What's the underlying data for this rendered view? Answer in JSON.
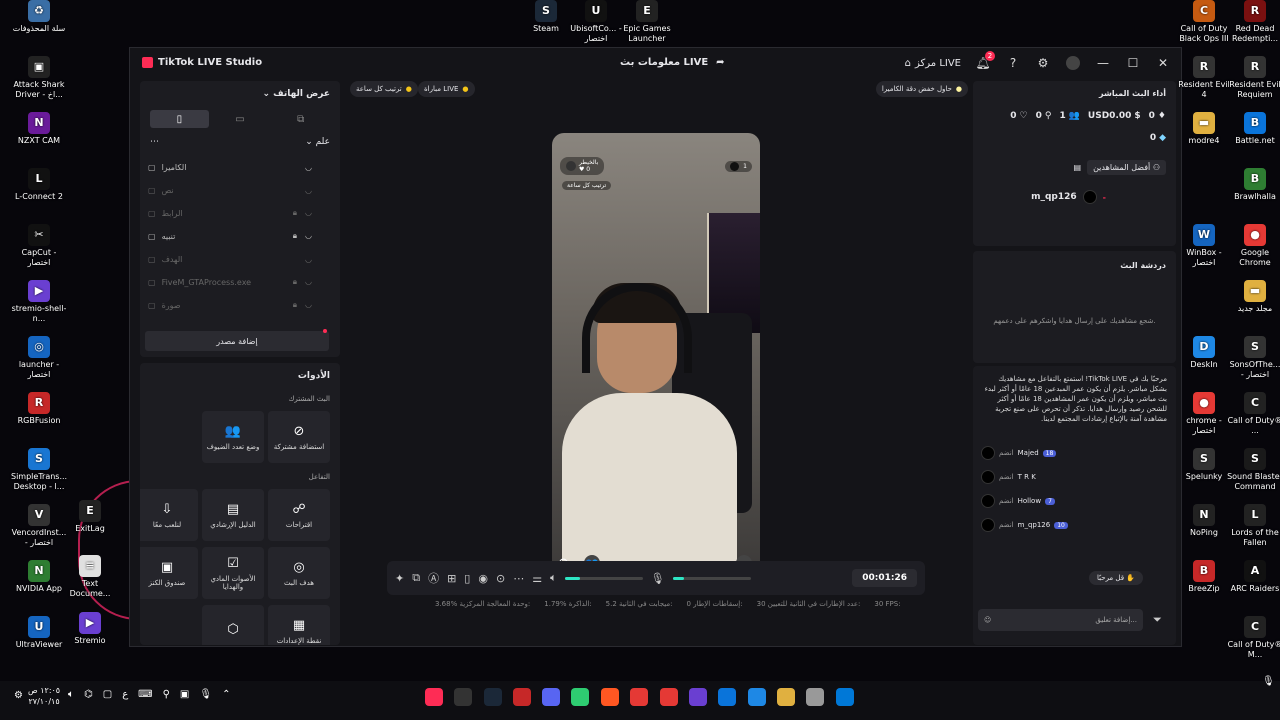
{
  "desktop_left": [
    {
      "label": "سلة المحذوفات",
      "color": "#3a6ea5",
      "glyph": "♻"
    },
    {
      "label": "Attack Shark Driver - اخ...",
      "color": "#222",
      "glyph": "▣"
    },
    {
      "label": "NZXT CAM",
      "color": "#6a1b9a",
      "glyph": "N"
    },
    {
      "label": "L-Connect 2",
      "color": "#111",
      "glyph": "L"
    },
    {
      "label": "CapCut - اختصار",
      "color": "#111",
      "glyph": "✂"
    },
    {
      "label": "stremio-shell-n...",
      "color": "#6a3fd1",
      "glyph": "▶"
    },
    {
      "label": "launcher - اختصار",
      "color": "#1565c0",
      "glyph": "◎"
    },
    {
      "label": "RGBFusion",
      "color": "#c62828",
      "glyph": "R"
    },
    {
      "label": "SimpleTrans... Desktop - l...",
      "color": "#1976d2",
      "glyph": "S"
    },
    {
      "label": "VencordInst... - اختصار",
      "color": "#333",
      "glyph": "V"
    },
    {
      "label": "NVIDIA App",
      "color": "#2e7d32",
      "glyph": "N"
    },
    {
      "label": "UltraViewer",
      "color": "#1565c0",
      "glyph": "U"
    }
  ],
  "desktop_left2": [
    {
      "label": "ExitLag",
      "color": "#222",
      "glyph": "E"
    },
    {
      "label": "Text Docume...",
      "color": "#e0e0e0",
      "glyph": "≡"
    },
    {
      "label": "Stremio",
      "color": "#6a3fd1",
      "glyph": "▶"
    }
  ],
  "desktop_top": [
    {
      "label": "Steam",
      "color": "#1b2838",
      "glyph": "S"
    },
    {
      "label": "UbisoftCo... - اختصار",
      "color": "#111",
      "glyph": "U"
    },
    {
      "label": "Epic Games Launcher",
      "color": "#222",
      "glyph": "E"
    }
  ],
  "desktop_right1": [
    {
      "label": "Call of Duty Black Ops III",
      "color": "#c55a11",
      "glyph": "C"
    },
    {
      "label": "Resident Evil 4",
      "color": "#333",
      "glyph": "R"
    },
    {
      "label": "modre4",
      "color": "#e0b040",
      "glyph": "▬"
    },
    {
      "label": "",
      "color": "transparent",
      "glyph": ""
    },
    {
      "label": "WinBox - اختصار",
      "color": "#1565c0",
      "glyph": "W"
    },
    {
      "label": "",
      "color": "transparent",
      "glyph": ""
    },
    {
      "label": "DeskIn",
      "color": "#1e88e5",
      "glyph": "D"
    },
    {
      "label": "chrome - اختصار",
      "color": "#e53935",
      "glyph": "●"
    },
    {
      "label": "Spelunky",
      "color": "#333",
      "glyph": "S"
    },
    {
      "label": "NoPing",
      "color": "#222",
      "glyph": "N"
    },
    {
      "label": "BreeZip",
      "color": "#c62828",
      "glyph": "B"
    }
  ],
  "desktop_right2": [
    {
      "label": "Red Dead Redempti...",
      "color": "#7a1010",
      "glyph": "R"
    },
    {
      "label": "Resident Evil Requiem",
      "color": "#333",
      "glyph": "R"
    },
    {
      "label": "Battle.net",
      "color": "#0a74da",
      "glyph": "B"
    },
    {
      "label": "Brawlhalla",
      "color": "#2e7d32",
      "glyph": "B"
    },
    {
      "label": "Google Chrome",
      "color": "#e53935",
      "glyph": "●"
    },
    {
      "label": "مجلد جديد",
      "color": "#e0b040",
      "glyph": "▬"
    },
    {
      "label": "SonsOfThe... - اختصار",
      "color": "#333",
      "glyph": "S"
    },
    {
      "label": "Call of Duty® ...",
      "color": "#222",
      "glyph": "C"
    },
    {
      "label": "Sound Blaster Command",
      "color": "#1a1a1a",
      "glyph": "S"
    },
    {
      "label": "Lords of the Fallen",
      "color": "#222",
      "glyph": "L"
    },
    {
      "label": "ARC Raiders",
      "color": "#111",
      "glyph": "A"
    },
    {
      "label": "Call of Duty® M...",
      "color": "#222",
      "glyph": "C"
    }
  ],
  "app": {
    "title": "TikTok LIVE Studio",
    "center_label": "معلومات بث LIVE",
    "live_center": "مركز LIVE",
    "notif_count": "2"
  },
  "left": {
    "scene_title": "عرض الهاتف",
    "sources_header": "علم",
    "sources": [
      {
        "label": "الكاميرا",
        "dim": false,
        "lock": false
      },
      {
        "label": "نص",
        "dim": true,
        "lock": false
      },
      {
        "label": "الرابط",
        "dim": true,
        "lock": true
      },
      {
        "label": "تنبيه",
        "dim": false,
        "lock": true
      },
      {
        "label": "الهدف",
        "dim": true,
        "lock": false
      },
      {
        "label": "FiveM_GTAProcess.exe",
        "dim": true,
        "lock": true
      },
      {
        "label": "صورة",
        "dim": true,
        "lock": true
      }
    ],
    "add_source": "إضافة مصدر",
    "tools_title": "الأدوات",
    "shared_heading": "البث المشترك",
    "interaction_heading": "التفاعل",
    "tools": [
      {
        "label": "استضافة مشتركة",
        "glyph": "⊘"
      },
      {
        "label": "وضع تعدد الضيوف",
        "glyph": "👥"
      },
      {
        "label": "اقتراحات",
        "glyph": "☍"
      },
      {
        "label": "الدليل الإرشادي",
        "glyph": "▤"
      },
      {
        "label": "لنلعب معًا",
        "glyph": "⇩"
      },
      {
        "label": "هدف البث",
        "glyph": "◎"
      },
      {
        "label": "الأصوات المادي والهدايا",
        "glyph": "☑"
      },
      {
        "label": "صندوق الكنز",
        "glyph": "▣"
      },
      {
        "label": "نقطة الإعدادات",
        "glyph": "▦"
      },
      {
        "label": "",
        "glyph": "⬡"
      }
    ]
  },
  "stage": {
    "pill1": "ترتيب كل ساعة",
    "pill2": "مباراة LIVE",
    "pill3": "حاول خفض دقة الكاميرا",
    "phone_name": "بالخيطر",
    "phone_likes": "0",
    "phone_rank": "ترتيب كل ساعة",
    "phone_viewers": "1",
    "timer": "00:01:26",
    "volume": 0.2,
    "mic": 0.15
  },
  "stats": [
    {
      "label": "FPS:",
      "value": "30"
    },
    {
      "label": "عدد الإطارات في الثانية للتعيين:",
      "value": "30"
    },
    {
      "label": "إسقاطات الإطار:",
      "value": "0"
    },
    {
      "label": "ميجابت في الثانية:",
      "value": "5.2"
    },
    {
      "label": "الذاكرة:",
      "value": "1.79%"
    },
    {
      "label": "وحدة المعالجة المركزية:",
      "value": "3.68%"
    }
  ],
  "right": {
    "perf_title": "أداء البث المباشر",
    "counts": [
      {
        "glyph": "♡",
        "value": "0"
      },
      {
        "glyph": "⚲",
        "value": "0"
      },
      {
        "glyph": "👥",
        "value": "1"
      },
      {
        "glyph": "$",
        "value": "USD0.00"
      },
      {
        "glyph": "♦",
        "value": "0"
      }
    ],
    "count_second": "0",
    "top_viewers_tab": "أفضل المشاهدين",
    "viewer_name": "m_qp126",
    "chat_title": "دردشة البث",
    "chat_placeholder_text": "شجع مشاهديك على إرسال هدايا واشكرهم على دعمهم.",
    "chat_intro": "مرحبًا بك في TikTok LIVE! استمتع بالتفاعل مع مشاهديك بشكل مباشر. يلزم أن يكون عمر المبدعين 18 عامًا أو أكثر لبدء بث مباشر، ويلزم أن يكون عمر المشاهدين 18 عامًا أو أكثر للشحن رصيد وإرسال هدايا. تذكر أن تحرص على صنع تجربة مشاهدة آمنة بالإتباع إرشادات المجتمع لدينا.",
    "chat_rows": [
      {
        "name": "Majed",
        "joined": "انضم",
        "level": "18"
      },
      {
        "name": "T R K",
        "joined": "انضم",
        "level": ""
      },
      {
        "name": "Hollow",
        "joined": "انضم",
        "level": "7"
      },
      {
        "name": "m_qp126",
        "joined": "انضم",
        "level": "10"
      }
    ],
    "say_hi": "قل مرحبًا",
    "comment_placeholder": "إضافة تعليق..."
  },
  "clock": {
    "time": "١٢:٠٥ ص",
    "date": "٢٧/١٠/١٥"
  }
}
